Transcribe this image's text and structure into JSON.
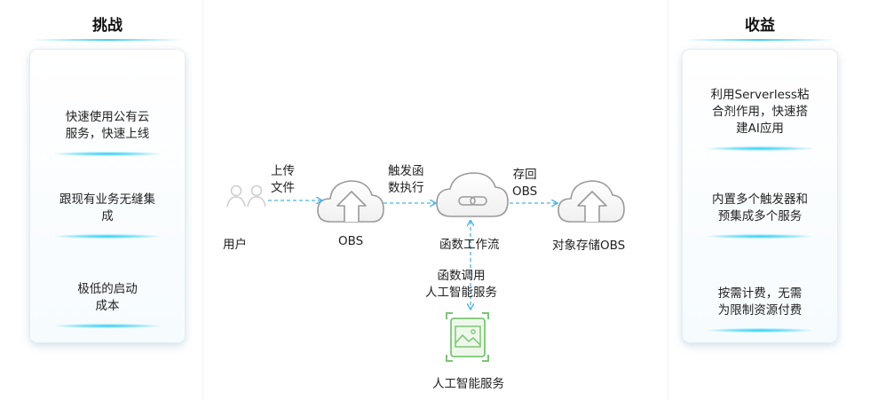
{
  "left_panel": {
    "title": "挑战",
    "items": [
      {
        "line1": "快速使用公有云",
        "line2": "服务，快速上线"
      },
      {
        "line1": "跟现有业务无缝集",
        "line2": "成"
      },
      {
        "line1": "极低的启动",
        "line2": "成本"
      }
    ]
  },
  "right_panel": {
    "title": "收益",
    "items": [
      {
        "line1": "利用Serverless粘",
        "line2": "合剂作用，快速搭",
        "line3": "建AI应用"
      },
      {
        "line1": "内置多个触发器和",
        "line2": "预集成多个服务"
      },
      {
        "line1": "按需计费，无需",
        "line2": "为限制资源付费"
      }
    ]
  },
  "nodes": {
    "user": "用户",
    "obs": "OBS",
    "workflow": "函数工作流",
    "target_obs": "对象存储OBS",
    "ai_service": "人工智能服务"
  },
  "edges": {
    "upload": {
      "line1": "上传",
      "line2": "文件"
    },
    "trigger": {
      "line1": "触发函",
      "line2": "数执行"
    },
    "store": {
      "line1": "存回",
      "line2": "OBS"
    },
    "call": {
      "line1": "函数调用",
      "line2": "人工智能服务"
    }
  },
  "colors": {
    "accent": "#2fcff4",
    "arrow": "#4ab3e6",
    "ai_green": "#7cc576",
    "cloud_stroke": "#9a9a9a"
  }
}
